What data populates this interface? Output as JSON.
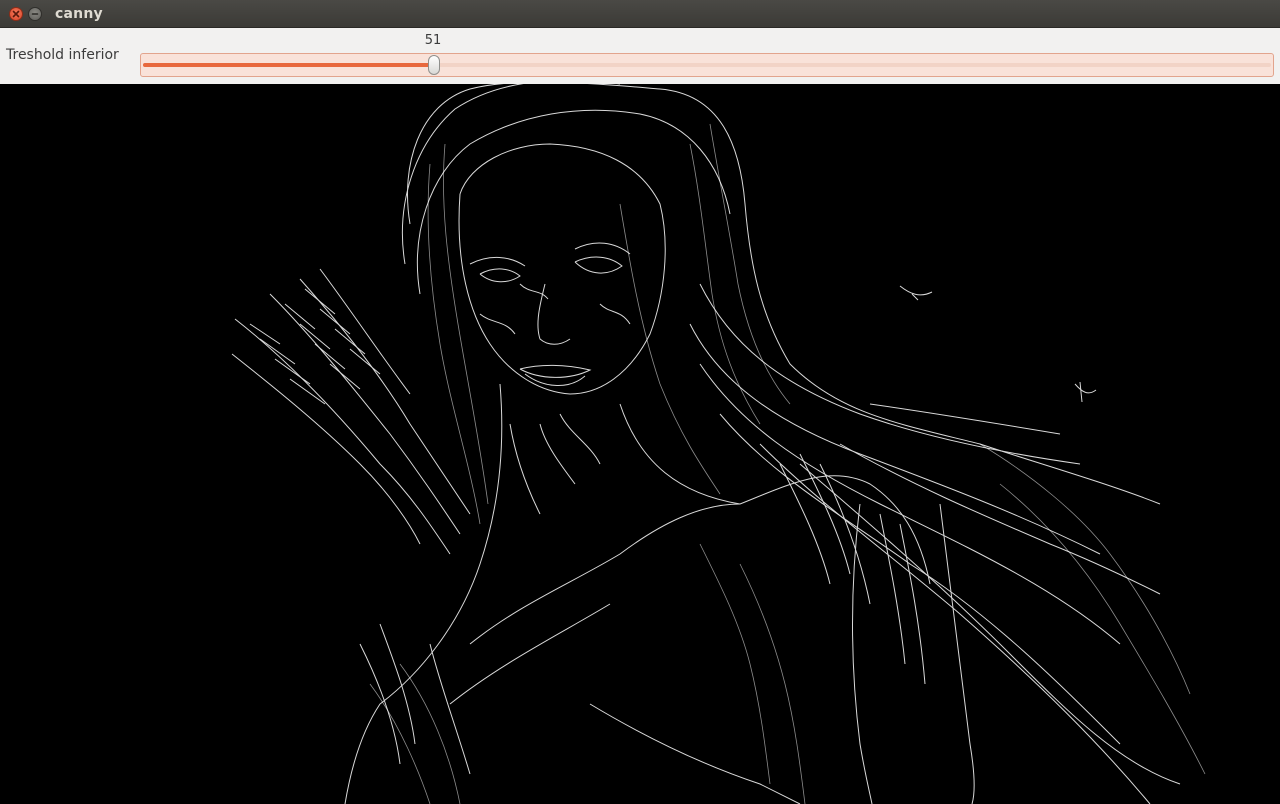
{
  "window": {
    "title": "canny"
  },
  "trackbar": {
    "label": "Treshold inferior",
    "value": "51",
    "fraction": 0.2578
  },
  "image": {
    "icon": "canny-edge-image",
    "background": "#000000",
    "edge_color": "#ffffff"
  },
  "colors": {
    "accent": "#e8683d",
    "close": "#e4583a"
  }
}
